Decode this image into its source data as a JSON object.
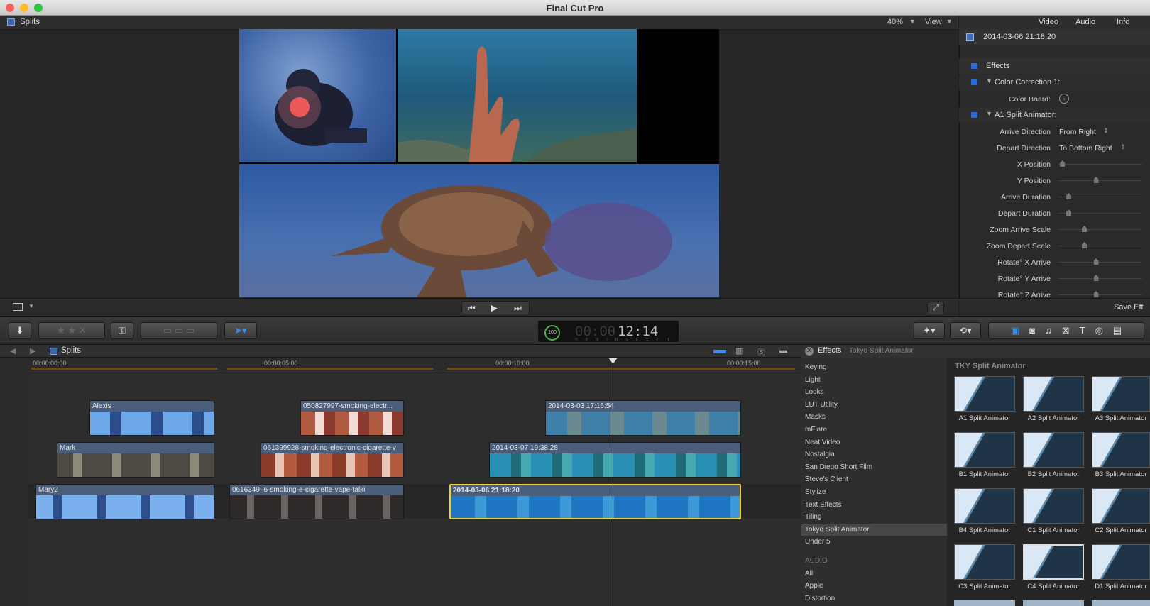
{
  "window": {
    "title": "Final Cut Pro"
  },
  "viewer": {
    "project_name": "Splits",
    "zoom": "40%",
    "view_label": "View"
  },
  "inspector": {
    "tabs": [
      "Video",
      "Audio",
      "Info"
    ],
    "clip_title": "2014-03-06 21:18:20",
    "effects_label": "Effects",
    "color_correction": "Color Correction 1:",
    "color_board": "Color Board:",
    "split_animator": "A1 Split Animator:",
    "arrive_direction_label": "Arrive Direction",
    "arrive_direction_value": "From Right",
    "depart_direction_label": "Depart Direction",
    "depart_direction_value": "To Bottom Right",
    "sliders": [
      {
        "label": "X Position",
        "level": 0.02
      },
      {
        "label": "Y Position",
        "level": 0.45
      },
      {
        "label": "Arrive Duration",
        "level": 0.1
      },
      {
        "label": "Depart Duration",
        "level": 0.1
      },
      {
        "label": "Zoom Arrive Scale",
        "level": 0.3
      },
      {
        "label": "Zoom Depart Scale",
        "level": 0.3
      },
      {
        "label": "Rotate° X Arrive",
        "level": 0.45
      },
      {
        "label": "Rotate° Y Arrive",
        "level": 0.45
      },
      {
        "label": "Rotate° Z Arrive",
        "level": 0.45
      }
    ],
    "save_button": "Save Eff"
  },
  "toolbar": {
    "timecode": "12:14",
    "timecode_dim": "00:00",
    "counter": "100",
    "tc_units": [
      "HR",
      "MIN",
      "SEC",
      "FR"
    ]
  },
  "timeline": {
    "project_name": "Splits",
    "ruler": [
      "00:00:00:00",
      "00:00:05:00",
      "00:00:10:00",
      "00:00:15:00"
    ],
    "clips": {
      "alexis": "Alexis",
      "smoking1": "050827997-smoking-electr...",
      "turtle1": "2014-03-03 17:16:54",
      "mark": "Mark",
      "smoking2": "061399928-smoking-electronic-cigarette-v",
      "reef": "2014-03-07 19:38:28",
      "mary": "Mary2",
      "smoking3": "0616349–6-smoking-e-cigarette-vape-talki",
      "selected": "2014-03-06 21:18:20"
    }
  },
  "effects_browser": {
    "header": "Effects",
    "selected_category": "Tokyo Split Animator",
    "categories": [
      "Keying",
      "Light",
      "Looks",
      "LUT Utility",
      "Masks",
      "mFlare",
      "Neat Video",
      "Nostalgia",
      "San Diego Short Film",
      "Steve's Client",
      "Stylize",
      "Text Effects",
      "Tiling",
      "Tokyo Split Animator",
      "Under 5"
    ],
    "audio_header": "AUDIO",
    "audio_categories": [
      "All",
      "Apple",
      "Distortion"
    ],
    "group_title": "TKY Split Animator",
    "items": [
      "A1 Split Animator",
      "A2 Split Animator",
      "A3 Split Animator",
      "B1 Split Animator",
      "B2 Split Animator",
      "B3 Split Animator",
      "B4 Split Animator",
      "C1 Split Animator",
      "C2 Split Animator",
      "C3 Split Animator",
      "C4 Split Animator",
      "D1 Split Animator"
    ]
  }
}
